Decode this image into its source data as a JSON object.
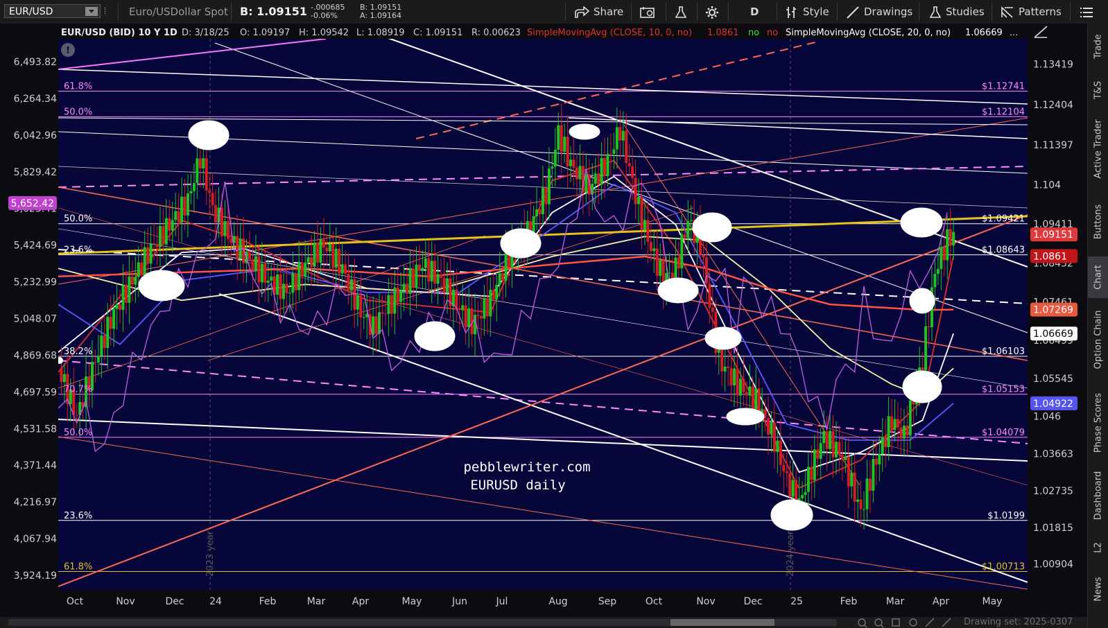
{
  "toolbar": {
    "symbol": "EUR/USD",
    "description": "Euro/USDollar Spot",
    "bid_display": "B: 1.09151",
    "change_1": "-.000685",
    "change_2": "-0.06%",
    "bid_small": "B: 1.09151",
    "ask_small": "A: 1.09164",
    "share_label": "Share",
    "period_label": "D",
    "style_label": "Style",
    "drawings_label": "Drawings",
    "studies_label": "Studies",
    "patterns_label": "Patterns"
  },
  "sidebar": {
    "tabs": [
      "Trade",
      "T&S",
      "Active Trader",
      "Buttons",
      "Chart",
      "Option Chain",
      "Phase Scores",
      "Dashboard",
      "L2",
      "News"
    ],
    "active": "Chart"
  },
  "header": {
    "title": "EUR/USD (BID) 10 Y 1D",
    "date": "D: 3/18/25",
    "open": "O: 1.09197",
    "high": "H: 1.09542",
    "low": "L: 1.08919",
    "close": "C: 1.09151",
    "range": "R: 0.00623",
    "sma10_label": "SimpleMovingAvg (CLOSE, 10, 0, no)",
    "sma10_value": "1.0861",
    "flag_no_1": "no",
    "flag_no_2": "no",
    "sma20_label": "SimpleMovingAvg (CLOSE, 20, 0, no)",
    "sma20_value": "1.06669",
    "more": "..."
  },
  "footer": {
    "drawing_set": "Drawing set: 2025-0307"
  },
  "annotation": {
    "line1": "pebblewriter.com",
    "line2": "EURUSD daily"
  },
  "colors": {
    "background": "#06063a",
    "yellow": "#e8c21a",
    "white_line": "#ffffff",
    "red_line": "#ff5a4a",
    "magenta": "#ff80ff",
    "blue_ma": "#5a5aff"
  },
  "chart_data": {
    "type": "line",
    "title": "EUR/USD (BID) 10 Y 1D",
    "x_ticks": [
      "Oct",
      "Nov",
      "Dec",
      "24",
      "Feb",
      "Mar",
      "Apr",
      "May",
      "Jun",
      "Jul",
      "Aug",
      "Sep",
      "Oct",
      "Nov",
      "Dec",
      "25",
      "Feb",
      "Mar",
      "Apr",
      "May"
    ],
    "year_markers": [
      "2023 year",
      "2024 year"
    ],
    "right_axis_ticks": [
      "1.13419",
      "1.12404",
      "1.11397",
      "1.104",
      "1.09411",
      "1.08432",
      "1.07461",
      "1.06499",
      "1.05545",
      "1.046",
      "1.03663",
      "1.02735",
      "1.01815",
      "1.00904"
    ],
    "left_axis_ticks": [
      "6,493.82",
      "6,264.34",
      "6,042.96",
      "5,829.42",
      "5,625.41",
      "5,424.69",
      "5,232.99",
      "5,048.07",
      "4,869.68",
      "4,697.59",
      "4,531.58",
      "4,371.44",
      "4,216.97",
      "4,067.94",
      "3,924.19"
    ],
    "left_marker": {
      "label": "5,652.42",
      "value": 5652.42
    },
    "right_markers": [
      {
        "label": "1.09151",
        "value": 1.09151,
        "color": "#e0393d"
      },
      {
        "label": "1.0861",
        "value": 1.0861,
        "color": "#c0151a"
      },
      {
        "label": "1.07269",
        "value": 1.07269,
        "color": "#e85a3f"
      },
      {
        "label": "1.06669",
        "value": 1.06669,
        "color": "#ffffff"
      },
      {
        "label": "1.04922",
        "value": 1.04922,
        "color": "#5555ee"
      }
    ],
    "left_fib_labels": [
      {
        "label": "61.8%",
        "value": 1.1274
      },
      {
        "label": "50.0%",
        "value": 1.121
      },
      {
        "label": "50.0%",
        "value": 1.0942
      },
      {
        "label": "23.6%",
        "value": 1.0864
      },
      {
        "label": "38.2%",
        "value": 1.061
      },
      {
        "label": "70.7%",
        "value": 1.0515
      },
      {
        "label": "50.0%",
        "value": 1.0407
      },
      {
        "label": "23.6%",
        "value": 1.0199
      },
      {
        "label": "61.8%",
        "value": 1.0071
      }
    ],
    "right_price_labels": [
      {
        "label": "$1.12741",
        "value": 1.1274
      },
      {
        "label": "$1.12104",
        "value": 1.121
      },
      {
        "label": "$1.09421",
        "value": 1.0942
      },
      {
        "label": "$1.08643",
        "value": 1.0864
      },
      {
        "label": "$1.06103",
        "value": 1.061
      },
      {
        "label": "$1.05153",
        "value": 1.0515
      },
      {
        "label": "$1.04079",
        "value": 1.0407
      },
      {
        "label": "$1.0199",
        "value": 1.0199
      },
      {
        "label": "$1.00713",
        "value": 1.0071
      }
    ],
    "price_path": [
      [
        0,
        1.058
      ],
      [
        3,
        1.046
      ],
      [
        6,
        1.06
      ],
      [
        9,
        1.072
      ],
      [
        12,
        1.08
      ],
      [
        15,
        1.088
      ],
      [
        18,
        1.094
      ],
      [
        21,
        1.1
      ],
      [
        23,
        1.111
      ],
      [
        25,
        1.098
      ],
      [
        28,
        1.09
      ],
      [
        31,
        1.085
      ],
      [
        34,
        1.08
      ],
      [
        37,
        1.077
      ],
      [
        40,
        1.084
      ],
      [
        43,
        1.089
      ],
      [
        46,
        1.083
      ],
      [
        49,
        1.072
      ],
      [
        51,
        1.068
      ],
      [
        53,
        1.073
      ],
      [
        56,
        1.078
      ],
      [
        59,
        1.084
      ],
      [
        62,
        1.08
      ],
      [
        65,
        1.073
      ],
      [
        67,
        1.069
      ],
      [
        70,
        1.075
      ],
      [
        73,
        1.086
      ],
      [
        76,
        1.092
      ],
      [
        79,
        1.102
      ],
      [
        81,
        1.117
      ],
      [
        83,
        1.109
      ],
      [
        86,
        1.103
      ],
      [
        89,
        1.11
      ],
      [
        91,
        1.118
      ],
      [
        94,
        1.098
      ],
      [
        96,
        1.088
      ],
      [
        98,
        1.08
      ],
      [
        100,
        1.083
      ],
      [
        102,
        1.095
      ],
      [
        104,
        1.089
      ],
      [
        107,
        1.06
      ],
      [
        110,
        1.054
      ],
      [
        113,
        1.05
      ],
      [
        116,
        1.04
      ],
      [
        118,
        1.03
      ],
      [
        120,
        1.024
      ],
      [
        122,
        1.033
      ],
      [
        124,
        1.041
      ],
      [
        127,
        1.036
      ],
      [
        130,
        1.022
      ],
      [
        132,
        1.033
      ],
      [
        135,
        1.045
      ],
      [
        137,
        1.041
      ],
      [
        140,
        1.06
      ],
      [
        142,
        1.082
      ],
      [
        144,
        1.09
      ],
      [
        145,
        1.0915
      ]
    ],
    "moving_averages": [
      {
        "name": "SimpleMovingAvg (CLOSE, 10, 0, no)",
        "color": "#e0302a",
        "points": [
          [
            0,
            1.057
          ],
          [
            20,
            1.095
          ],
          [
            30,
            1.09
          ],
          [
            50,
            1.075
          ],
          [
            70,
            1.072
          ],
          [
            80,
            1.105
          ],
          [
            90,
            1.11
          ],
          [
            100,
            1.088
          ],
          [
            110,
            1.058
          ],
          [
            120,
            1.028
          ],
          [
            130,
            1.035
          ],
          [
            140,
            1.05
          ],
          [
            145,
            1.0861
          ]
        ]
      },
      {
        "name": "SimpleMovingAvg (CLOSE, 20, 0, no)",
        "color": "#ffffff",
        "points": [
          [
            0,
            1.062
          ],
          [
            20,
            1.087
          ],
          [
            30,
            1.088
          ],
          [
            50,
            1.078
          ],
          [
            70,
            1.076
          ],
          [
            80,
            1.097
          ],
          [
            90,
            1.106
          ],
          [
            100,
            1.094
          ],
          [
            110,
            1.062
          ],
          [
            120,
            1.032
          ],
          [
            130,
            1.037
          ],
          [
            140,
            1.045
          ],
          [
            145,
            1.06669
          ]
        ]
      },
      {
        "name": "",
        "color": "#5a5aff",
        "points": [
          [
            0,
            1.074
          ],
          [
            10,
            1.064
          ],
          [
            20,
            1.08
          ],
          [
            35,
            1.083
          ],
          [
            50,
            1.077
          ],
          [
            65,
            1.077
          ],
          [
            80,
            1.093
          ],
          [
            90,
            1.104
          ],
          [
            100,
            1.097
          ],
          [
            110,
            1.068
          ],
          [
            118,
            1.044
          ],
          [
            128,
            1.04
          ],
          [
            138,
            1.04
          ],
          [
            145,
            1.04922
          ]
        ]
      },
      {
        "name": "",
        "color": "#f7f0a8",
        "points": [
          [
            0,
            1.083
          ],
          [
            20,
            1.075
          ],
          [
            40,
            1.079
          ],
          [
            60,
            1.077
          ],
          [
            80,
            1.086
          ],
          [
            95,
            1.091
          ],
          [
            105,
            1.09
          ],
          [
            115,
            1.078
          ],
          [
            125,
            1.063
          ],
          [
            135,
            1.054
          ],
          [
            140,
            1.051
          ],
          [
            145,
            1.058
          ]
        ]
      },
      {
        "name": "",
        "color": "#ff5540",
        "points": [
          [
            0,
            1.081
          ],
          [
            20,
            1.082
          ],
          [
            40,
            1.083
          ],
          [
            60,
            1.081
          ],
          [
            80,
            1.084
          ],
          [
            95,
            1.086
          ],
          [
            105,
            1.083
          ],
          [
            115,
            1.078
          ],
          [
            125,
            1.074
          ],
          [
            140,
            1.0726
          ],
          [
            145,
            1.07269
          ]
        ]
      }
    ],
    "xlim": [
      0,
      157
    ],
    "ylim": [
      1.0025,
      1.1405
    ]
  }
}
